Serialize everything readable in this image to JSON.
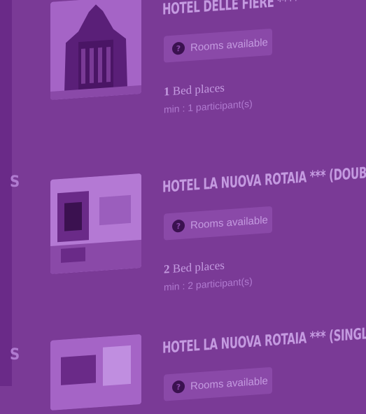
{
  "colors": {
    "background": "#7a3a96",
    "sidebar": "#6a2a88",
    "title_text": "#c49ae0",
    "button_bg": "#8a49a8"
  },
  "hotels": [
    {
      "name": "HOTEL DELLE FIERE ****",
      "rooms_label": "Rooms available",
      "bed_count": "1",
      "bed_label": "Bed places",
      "min_participants": "min : 1 participant(s)"
    },
    {
      "name": "HOTEL LA NUOVA ROTAIA *** (DOUBLE ROOM)",
      "rooms_label": "Rooms available",
      "bed_count": "2",
      "bed_label": "Bed places",
      "min_participants": "min : 2 participant(s)"
    },
    {
      "name": "HOTEL LA NUOVA ROTAIA *** (SINGLE ROOM)",
      "rooms_label": "Rooms available",
      "bed_count": "",
      "bed_label": "",
      "min_participants": ""
    }
  ],
  "edge_marks": [
    "S",
    "S"
  ],
  "icons": {
    "rooms": "question-circle-icon"
  }
}
